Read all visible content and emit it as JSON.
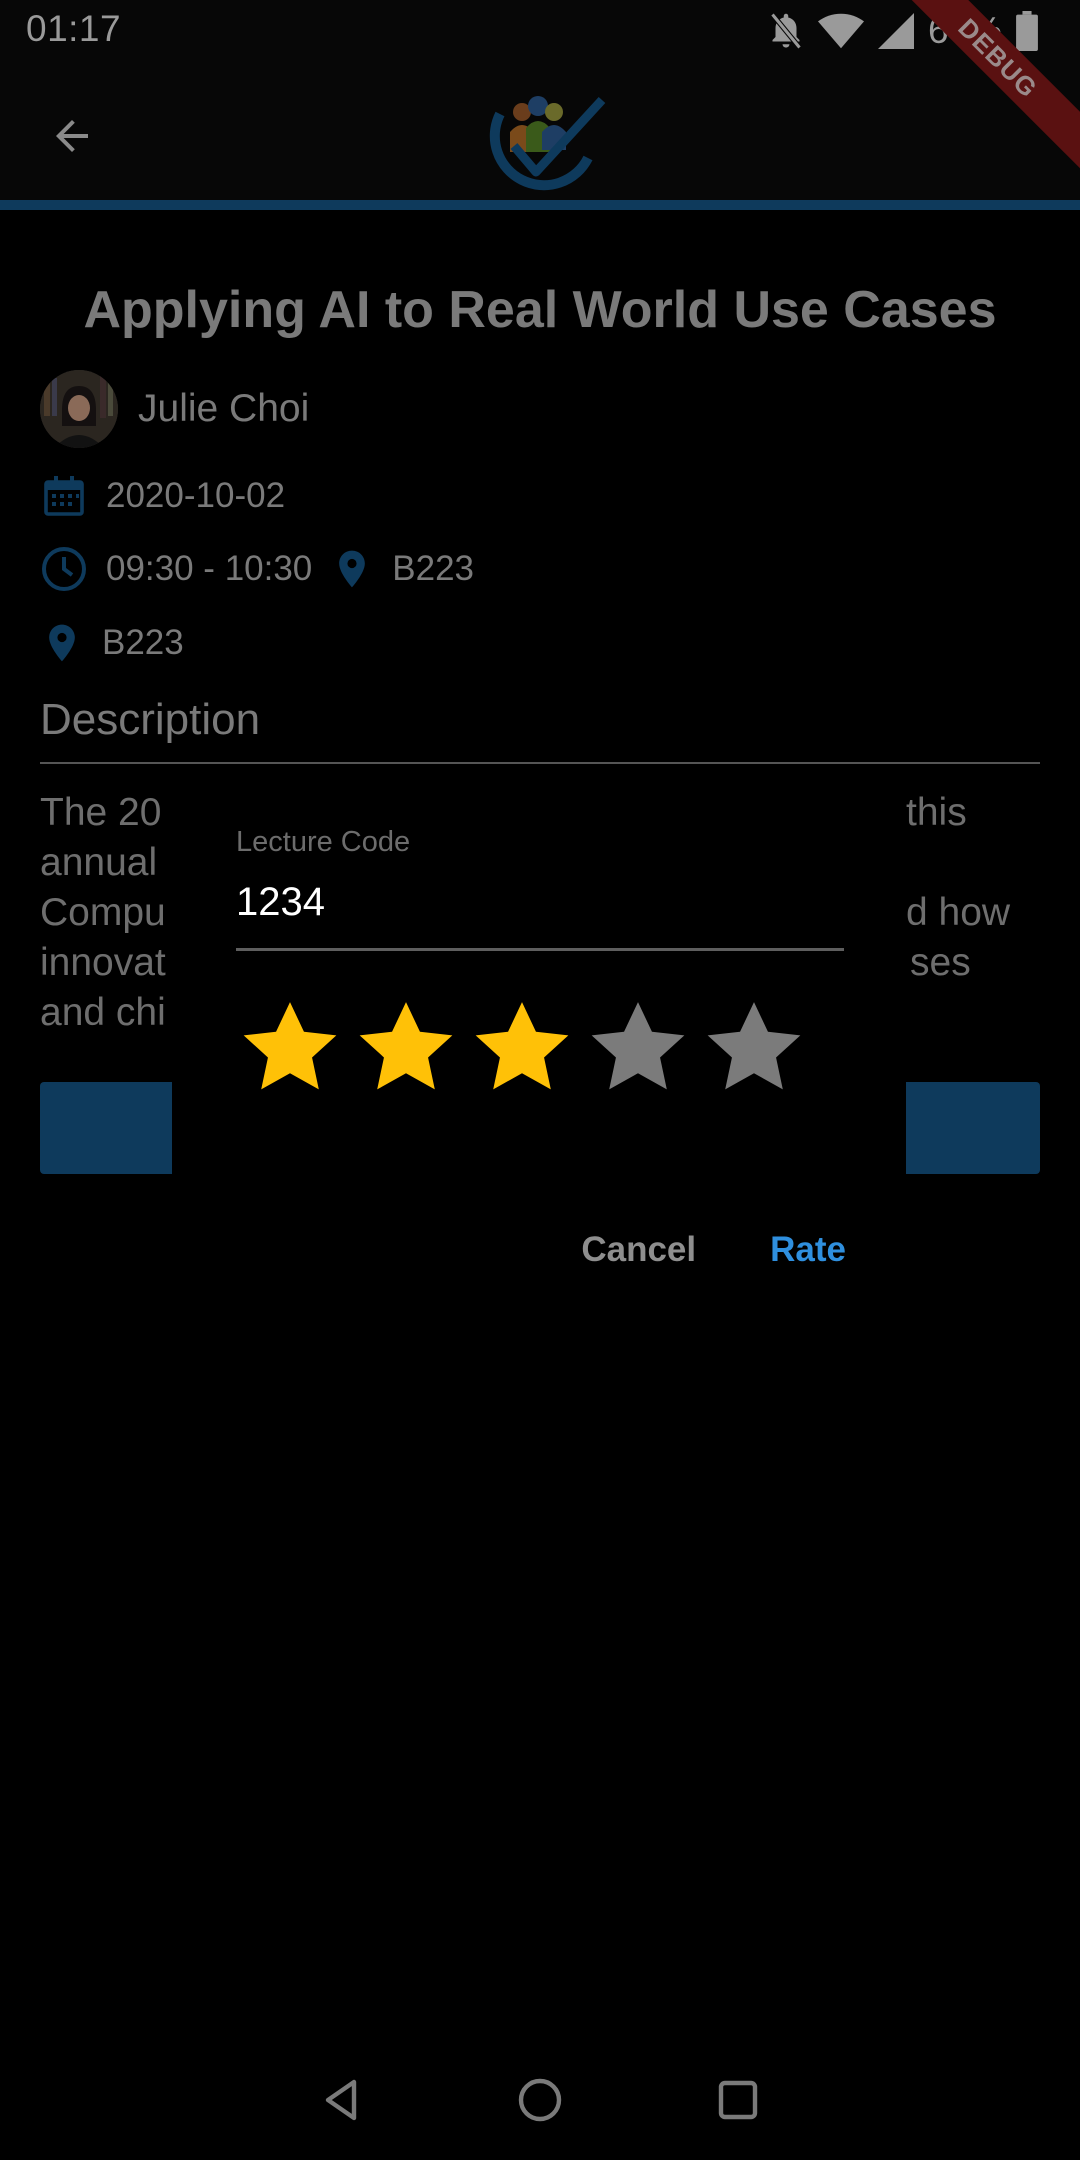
{
  "status_bar": {
    "time": "01:17",
    "battery": "67%",
    "icons": [
      "notifications-off-icon",
      "wifi-icon",
      "signal-icon",
      "battery-icon"
    ]
  },
  "app_bar": {
    "back_icon": "arrow-back-icon",
    "logo": "attendance-logo",
    "debug_label": "DEBUG",
    "accent_color": "#1565a0"
  },
  "lecture": {
    "title": "Applying AI to Real World Use Cases",
    "speaker": "Julie Choi",
    "date": "2020-10-02",
    "time": "09:30 - 10:30",
    "location_inline": "B223",
    "location": "B223"
  },
  "description": {
    "heading": "Description",
    "lines": [
      "The 20",
      "annual",
      "Compu",
      "innovat",
      "and chi"
    ],
    "right_fragments": [
      "this",
      "",
      "d how",
      "ses",
      ""
    ]
  },
  "dialog": {
    "field_label": "Lecture Code",
    "field_value": "1234",
    "rating": 3,
    "max_rating": 5,
    "star_on_color": "#ffc107",
    "star_off_color": "#7b7b7b",
    "cancel_label": "Cancel",
    "rate_label": "Rate"
  },
  "nav_bar": {
    "icons": [
      "back-nav-icon",
      "home-nav-icon",
      "recents-nav-icon"
    ]
  }
}
